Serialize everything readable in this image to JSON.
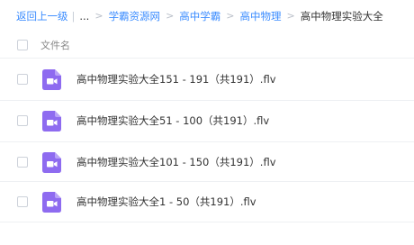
{
  "breadcrumb": {
    "back": "返回上一级",
    "ellipsis": "...",
    "items": [
      "学霸资源网",
      "高中学霸",
      "高中物理"
    ],
    "current": "高中物理实验大全"
  },
  "list_header": {
    "name_label": "文件名"
  },
  "files": [
    {
      "name": "高中物理实验大全151 - 191（共191）.flv",
      "icon": "video-file-icon"
    },
    {
      "name": "高中物理实验大全51 - 100（共191）.flv",
      "icon": "video-file-icon"
    },
    {
      "name": "高中物理实验大全101 - 150（共191）.flv",
      "icon": "video-file-icon"
    },
    {
      "name": "高中物理实验大全1 - 50（共191）.flv",
      "icon": "video-file-icon"
    }
  ],
  "colors": {
    "link": "#3b8cff",
    "video_icon": "#8e6bf0"
  }
}
